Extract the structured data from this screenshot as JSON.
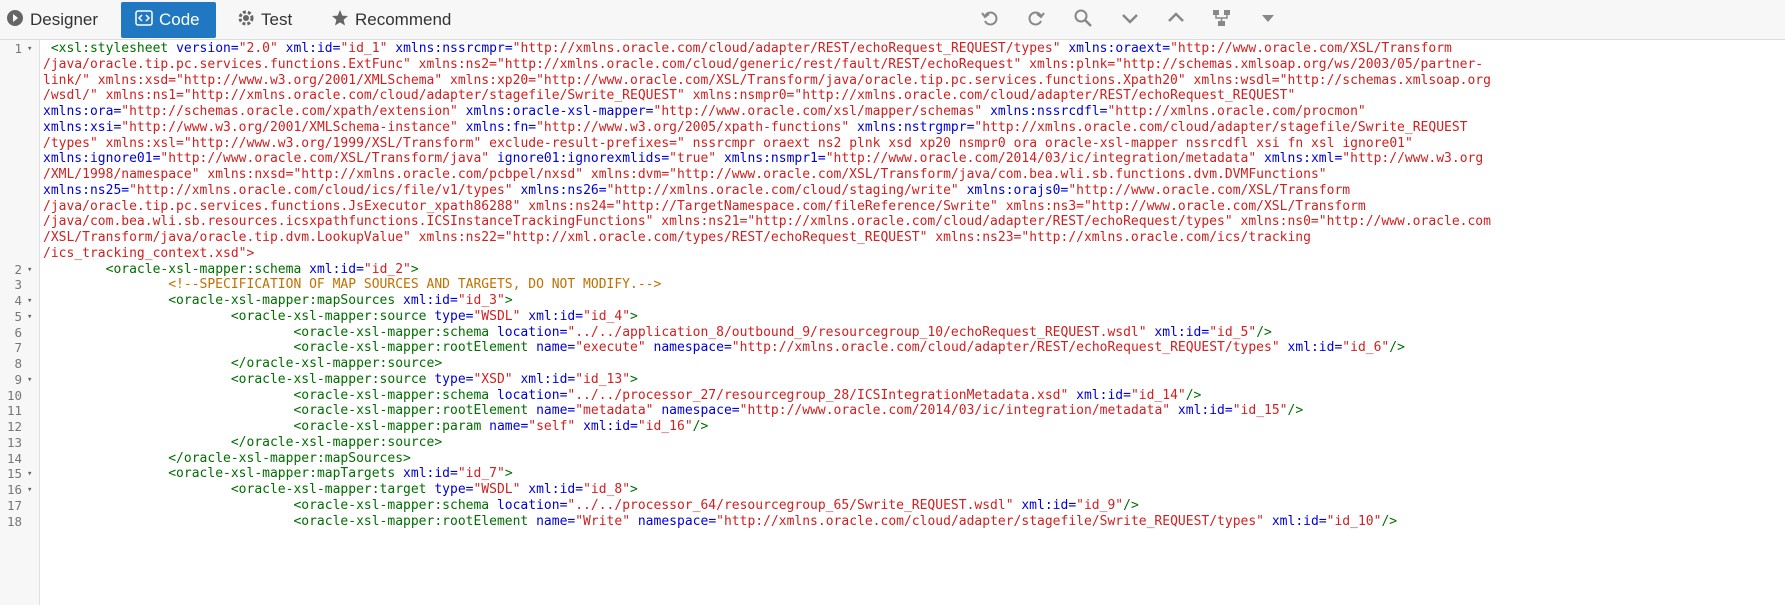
{
  "tabs": [
    {
      "label": "Designer",
      "icon": "circle-arrow-icon"
    },
    {
      "label": "Code",
      "icon": "code-icon"
    },
    {
      "label": "Test",
      "icon": "gear-icon"
    },
    {
      "label": "Recommend",
      "icon": "star-icon"
    }
  ],
  "toolbar_actions": [
    "undo-icon",
    "redo-icon",
    "search-icon",
    "next-icon",
    "previous-icon",
    "tree-icon",
    "more-icon"
  ],
  "editor": {
    "lines": [
      {
        "num": "1",
        "fold": "▾",
        "text": " <xsl:stylesheet version=\"2.0\" xml:id=\"id_1\" xmlns:nssrcmpr=\"http://xmlns.oracle.com/cloud/adapter/REST/echoRequest_REQUEST/types\" xmlns:oraext=\"http://www.oracle.com/XSL/Transform"
      },
      {
        "num": "",
        "fold": "",
        "text": "/java/oracle.tip.pc.services.functions.ExtFunc\" xmlns:ns2=\"http://xmlns.oracle.com/cloud/generic/rest/fault/REST/echoRequest\" xmlns:plnk=\"http://schemas.xmlsoap.org/ws/2003/05/partner-"
      },
      {
        "num": "",
        "fold": "",
        "text": "link/\" xmlns:xsd=\"http://www.w3.org/2001/XMLSchema\" xmlns:xp20=\"http://www.oracle.com/XSL/Transform/java/oracle.tip.pc.services.functions.Xpath20\" xmlns:wsdl=\"http://schemas.xmlsoap.org"
      },
      {
        "num": "",
        "fold": "",
        "text": "/wsdl/\" xmlns:ns1=\"http://xmlns.oracle.com/cloud/adapter/stagefile/Swrite_REQUEST\" xmlns:nsmpr0=\"http://xmlns.oracle.com/cloud/adapter/REST/echoRequest_REQUEST\""
      },
      {
        "num": "",
        "fold": "",
        "text": "xmlns:ora=\"http://schemas.oracle.com/xpath/extension\" xmlns:oracle-xsl-mapper=\"http://www.oracle.com/xsl/mapper/schemas\" xmlns:nssrcdfl=\"http://xmlns.oracle.com/procmon\""
      },
      {
        "num": "",
        "fold": "",
        "text": "xmlns:xsi=\"http://www.w3.org/2001/XMLSchema-instance\" xmlns:fn=\"http://www.w3.org/2005/xpath-functions\" xmlns:nstrgmpr=\"http://xmlns.oracle.com/cloud/adapter/stagefile/Swrite_REQUEST"
      },
      {
        "num": "",
        "fold": "",
        "text": "/types\" xmlns:xsl=\"http://www.w3.org/1999/XSL/Transform\" exclude-result-prefixes=\" nssrcmpr oraext ns2 plnk xsd xp20 nsmpr0 ora oracle-xsl-mapper nssrcdfl xsi fn xsl ignore01\""
      },
      {
        "num": "",
        "fold": "",
        "text": "xmlns:ignore01=\"http://www.oracle.com/XSL/Transform/java\" ignore01:ignorexmlids=\"true\" xmlns:nsmpr1=\"http://www.oracle.com/2014/03/ic/integration/metadata\" xmlns:xml=\"http://www.w3.org"
      },
      {
        "num": "",
        "fold": "",
        "text": "/XML/1998/namespace\" xmlns:nxsd=\"http://xmlns.oracle.com/pcbpel/nxsd\" xmlns:dvm=\"http://www.oracle.com/XSL/Transform/java/com.bea.wli.sb.functions.dvm.DVMFunctions\""
      },
      {
        "num": "",
        "fold": "",
        "text": "xmlns:ns25=\"http://xmlns.oracle.com/cloud/ics/file/v1/types\" xmlns:ns26=\"http://xmlns.oracle.com/cloud/staging/write\" xmlns:orajs0=\"http://www.oracle.com/XSL/Transform"
      },
      {
        "num": "",
        "fold": "",
        "text": "/java/oracle.tip.pc.services.functions.JsExecutor_xpath86288\" xmlns:ns24=\"http://TargetNamespace.com/fileReference/Swrite\" xmlns:ns3=\"http://www.oracle.com/XSL/Transform"
      },
      {
        "num": "",
        "fold": "",
        "text": "/java/com.bea.wli.sb.resources.icsxpathfunctions.ICSInstanceTrackingFunctions\" xmlns:ns21=\"http://xmlns.oracle.com/cloud/adapter/REST/echoRequest/types\" xmlns:ns0=\"http://www.oracle.com"
      },
      {
        "num": "",
        "fold": "",
        "text": "/XSL/Transform/java/oracle.tip.dvm.LookupValue\" xmlns:ns22=\"http://xml.oracle.com/types/REST/echoRequest_REQUEST\" xmlns:ns23=\"http://xmlns.oracle.com/ics/tracking"
      },
      {
        "num": "",
        "fold": "",
        "text": "/ics_tracking_context.xsd\">"
      },
      {
        "num": "2",
        "fold": "▾",
        "text": "        <oracle-xsl-mapper:schema xml:id=\"id_2\">"
      },
      {
        "num": "3",
        "fold": "",
        "text": "                <!--SPECIFICATION OF MAP SOURCES AND TARGETS, DO NOT MODIFY.-->"
      },
      {
        "num": "4",
        "fold": "▾",
        "text": "                <oracle-xsl-mapper:mapSources xml:id=\"id_3\">"
      },
      {
        "num": "5",
        "fold": "▾",
        "text": "                        <oracle-xsl-mapper:source type=\"WSDL\" xml:id=\"id_4\">"
      },
      {
        "num": "6",
        "fold": "",
        "text": "                                <oracle-xsl-mapper:schema location=\"../../application_8/outbound_9/resourcegroup_10/echoRequest_REQUEST.wsdl\" xml:id=\"id_5\"/>"
      },
      {
        "num": "7",
        "fold": "",
        "text": "                                <oracle-xsl-mapper:rootElement name=\"execute\" namespace=\"http://xmlns.oracle.com/cloud/adapter/REST/echoRequest_REQUEST/types\" xml:id=\"id_6\"/>"
      },
      {
        "num": "8",
        "fold": "",
        "text": "                        </oracle-xsl-mapper:source>"
      },
      {
        "num": "9",
        "fold": "▾",
        "text": "                        <oracle-xsl-mapper:source type=\"XSD\" xml:id=\"id_13\">"
      },
      {
        "num": "10",
        "fold": "",
        "text": "                                <oracle-xsl-mapper:schema location=\"../../processor_27/resourcegroup_28/ICSIntegrationMetadata.xsd\" xml:id=\"id_14\"/>"
      },
      {
        "num": "11",
        "fold": "",
        "text": "                                <oracle-xsl-mapper:rootElement name=\"metadata\" namespace=\"http://www.oracle.com/2014/03/ic/integration/metadata\" xml:id=\"id_15\"/>"
      },
      {
        "num": "12",
        "fold": "",
        "text": "                                <oracle-xsl-mapper:param name=\"self\" xml:id=\"id_16\"/>"
      },
      {
        "num": "13",
        "fold": "",
        "text": "                        </oracle-xsl-mapper:source>"
      },
      {
        "num": "14",
        "fold": "",
        "text": "                </oracle-xsl-mapper:mapSources>"
      },
      {
        "num": "15",
        "fold": "▾",
        "text": "                <oracle-xsl-mapper:mapTargets xml:id=\"id_7\">"
      },
      {
        "num": "16",
        "fold": "▾",
        "text": "                        <oracle-xsl-mapper:target type=\"WSDL\" xml:id=\"id_8\">"
      },
      {
        "num": "17",
        "fold": "",
        "text": "                                <oracle-xsl-mapper:schema location=\"../../processor_64/resourcegroup_65/Swrite_REQUEST.wsdl\" xml:id=\"id_9\"/>"
      },
      {
        "num": "18",
        "fold": "",
        "text": "                                <oracle-xsl-mapper:rootElement name=\"Write\" namespace=\"http://xmlns.oracle.com/cloud/adapter/stagefile/Swrite_REQUEST/types\" xml:id=\"id_10\"/>"
      }
    ]
  }
}
